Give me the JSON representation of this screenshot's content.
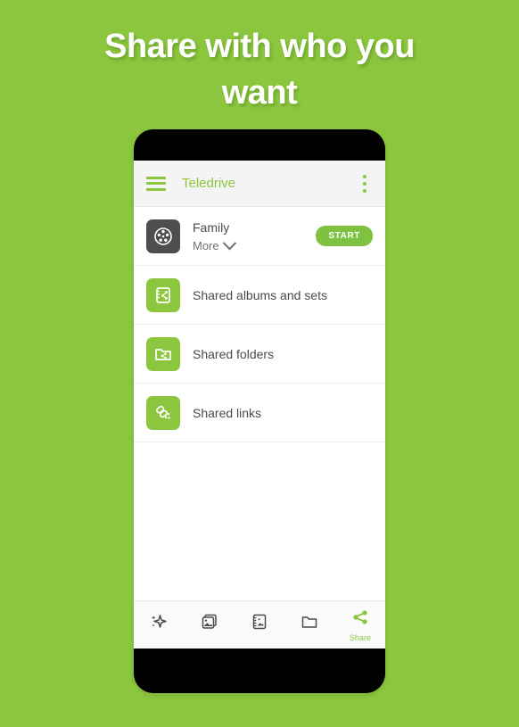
{
  "headline": "Share with who you want",
  "background_color": "#8cc63e",
  "accent_color": "#8cc63e",
  "appbar": {
    "menu_icon": "hamburger-menu-icon",
    "title": "Teledrive",
    "overflow_icon": "more-vertical-icon"
  },
  "list": [
    {
      "icon": "people-group-icon",
      "title": "Family",
      "subtitle": "More",
      "caret": "chevron-down-icon",
      "action_label": "START"
    },
    {
      "icon": "shared-album-icon",
      "title": "Shared albums and sets"
    },
    {
      "icon": "shared-folder-icon",
      "title": "Shared folders"
    },
    {
      "icon": "shared-link-icon",
      "title": "Shared links"
    }
  ],
  "bottom_nav": [
    {
      "icon": "sparkle-icon",
      "label": ""
    },
    {
      "icon": "photo-stack-icon",
      "label": ""
    },
    {
      "icon": "album-icon",
      "label": ""
    },
    {
      "icon": "folder-icon",
      "label": ""
    },
    {
      "icon": "share-icon",
      "label": "Share",
      "active": true
    }
  ]
}
